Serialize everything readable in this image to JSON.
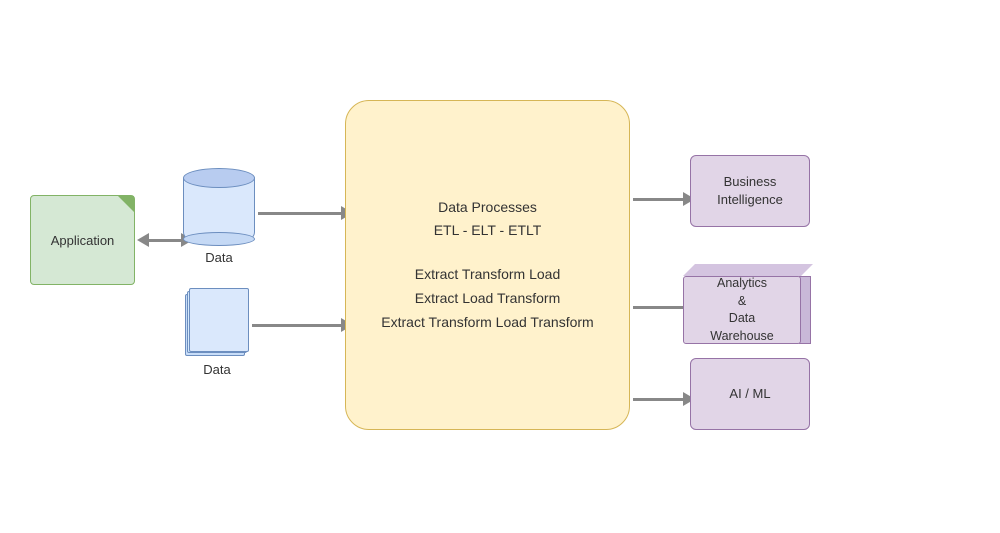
{
  "application": {
    "label": "Application"
  },
  "data_sources": [
    {
      "label": "Data",
      "type": "cylinder"
    },
    {
      "label": "Data",
      "type": "pages"
    }
  ],
  "process_box": {
    "title": "Data Processes",
    "subtitle": "ETL - ELT - ETLT",
    "lines": [
      "Extract Transform Load",
      "Extract Load Transform",
      "Extract Transform Load Transform"
    ]
  },
  "outputs": [
    {
      "label": "Business\nIntelligence",
      "type": "box"
    },
    {
      "label": "Analytics\n&\nData\nWarehouse",
      "type": "cube"
    },
    {
      "label": "AI / ML",
      "type": "box"
    }
  ],
  "colors": {
    "application_fill": "#d5e8d4",
    "application_border": "#82b366",
    "data_fill": "#dae8fc",
    "data_border": "#6c8ebf",
    "process_fill": "#fff2cc",
    "process_border": "#d6b656",
    "output_fill": "#e1d5e7",
    "output_border": "#9673a6",
    "arrow": "#888888"
  }
}
